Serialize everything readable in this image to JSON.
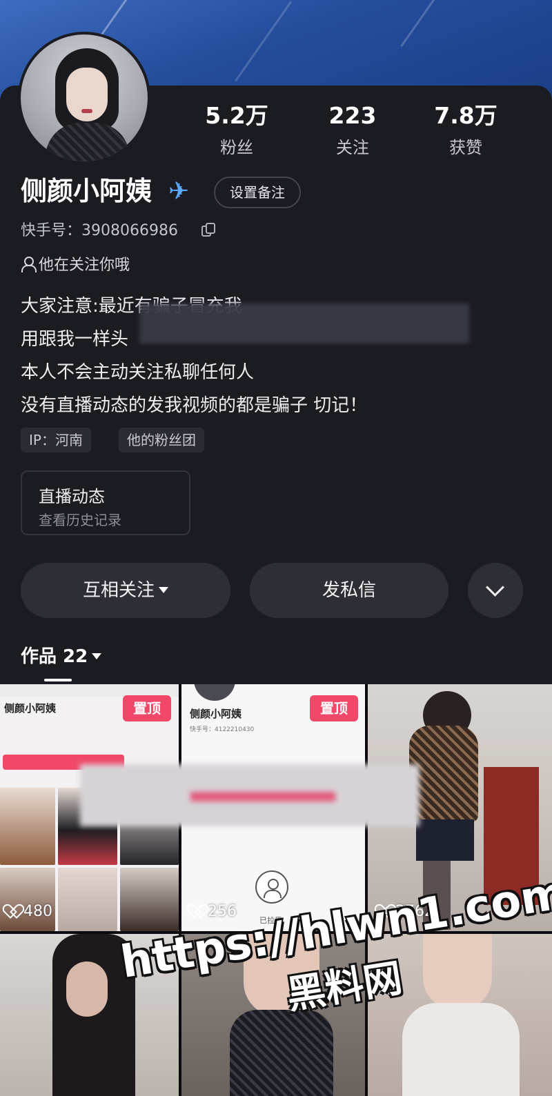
{
  "profile": {
    "name": "侧颜小阿姨",
    "name_icon": "airplane-icon",
    "remark_button": "设置备注",
    "kuaishou_id": "快手号：3908066986",
    "follow_hint": "他在关注你哦"
  },
  "stats": [
    {
      "value": "5.2万",
      "label": "粉丝"
    },
    {
      "value": "223",
      "label": "关注"
    },
    {
      "value": "7.8万",
      "label": "获赞"
    }
  ],
  "bio": [
    "大家注意:最近有骗子冒充我",
    "用跟我一样头",
    "本人不会主动关注私聊任何人",
    "没有直播动态的发我视频的都是骗子 切记！"
  ],
  "tags": [
    {
      "label": "IP：河南"
    },
    {
      "label": "他的粉丝团"
    }
  ],
  "live_card": {
    "title": "直播动态",
    "subtitle": "查看历史记录"
  },
  "actions": {
    "follow": "互相关注",
    "message": "发私信",
    "more_icon": "chevron-down-icon"
  },
  "works_tab": {
    "label": "作品 22"
  },
  "grid": {
    "cell1": {
      "name": "侧颜小阿姨",
      "pinned": "置顶",
      "likes": "480"
    },
    "cell2": {
      "name": "侧颜小阿姨",
      "pinned": "置顶",
      "likes": "256",
      "kid": "快手号：4122210430",
      "status": "已拉黑"
    },
    "cell3": {
      "likes": "2762"
    }
  },
  "watermark": {
    "url": "https://hlwn1.com",
    "text": "黑料网"
  },
  "colors": {
    "background": "#1b1b22",
    "button": "#2e2e36",
    "pinned": "#f04868",
    "cover": "#234c9b"
  }
}
